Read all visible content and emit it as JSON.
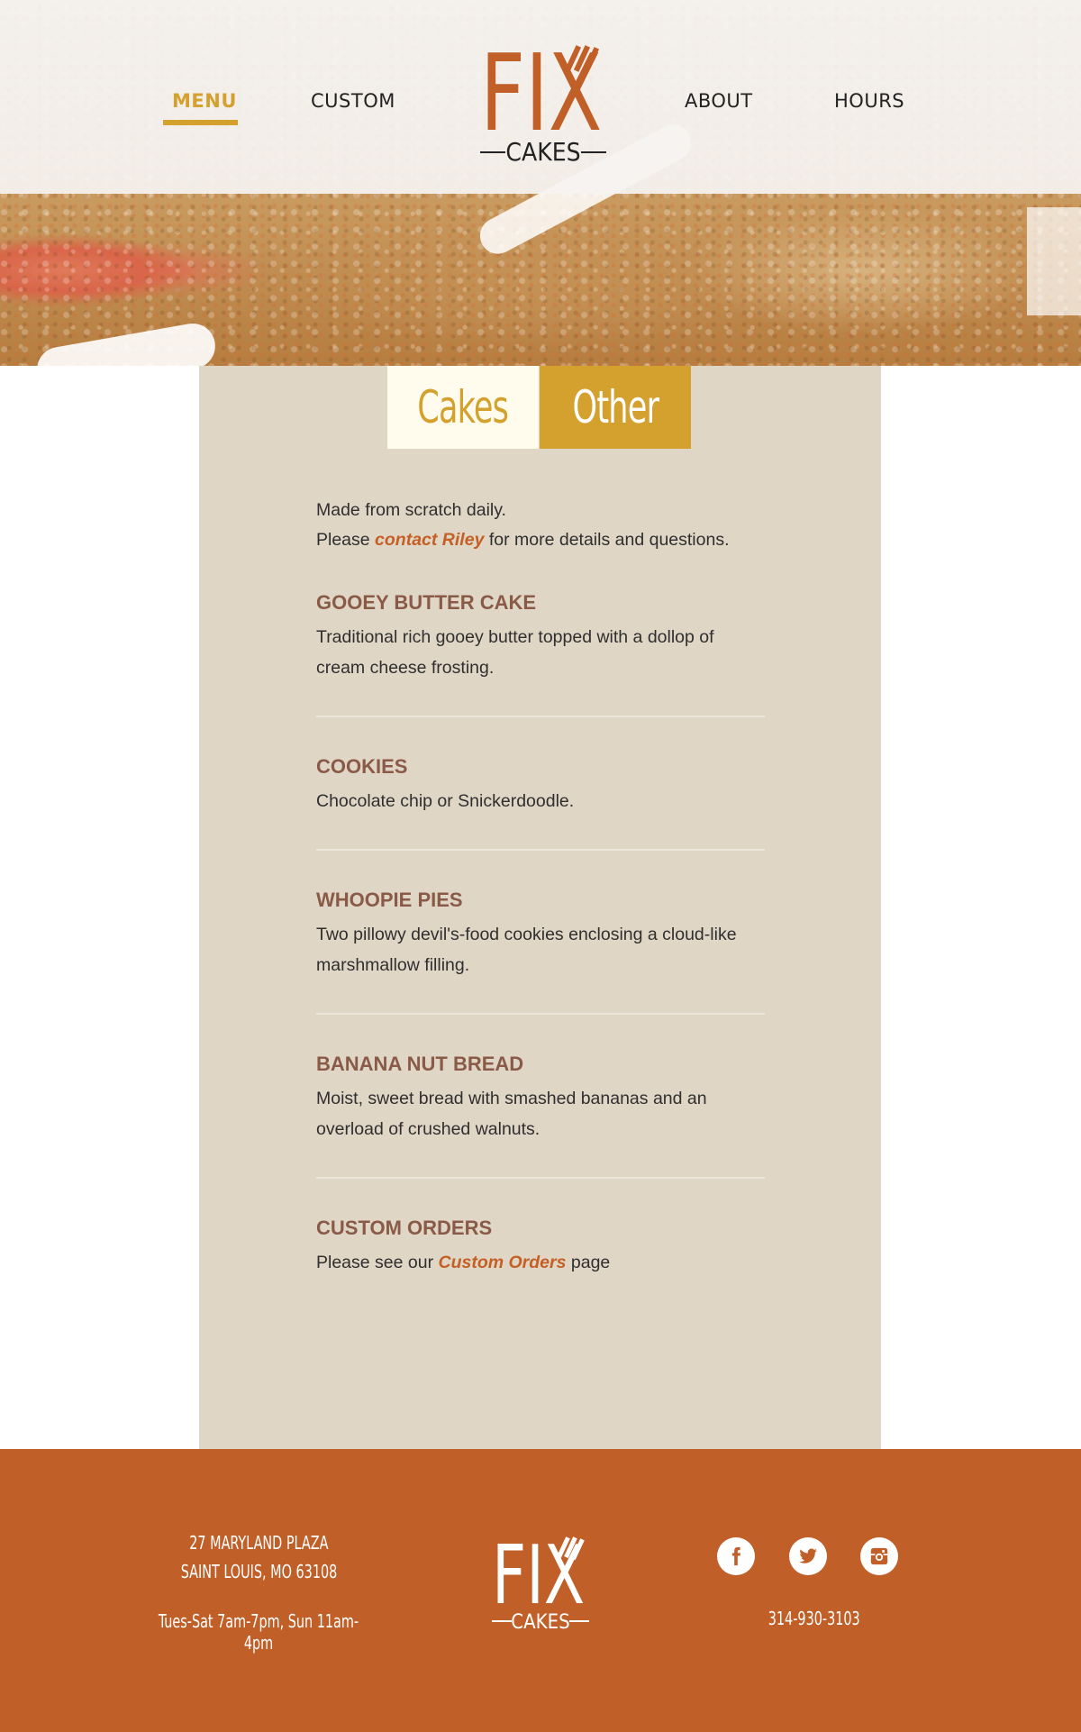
{
  "nav": {
    "left": [
      {
        "label": "MENU",
        "active": true
      },
      {
        "label": "CUSTOM",
        "active": false
      }
    ],
    "right": [
      {
        "label": "ABOUT"
      },
      {
        "label": "HOURS"
      }
    ],
    "logo": {
      "main": "FIX",
      "sub": "CAKES"
    }
  },
  "tabs": [
    {
      "label": "Cakes",
      "selected": false
    },
    {
      "label": "Other",
      "selected": true
    }
  ],
  "intro": {
    "line1": "Made from scratch daily.",
    "line2_before": "Please ",
    "line2_link": "contact Riley",
    "line2_after": " for more details and questions."
  },
  "items": [
    {
      "title": "GOOEY BUTTER CAKE",
      "description": "Traditional rich gooey butter topped with a dollop of cream cheese frosting."
    },
    {
      "title": "COOKIES",
      "description": "Chocolate chip or Snickerdoodle."
    },
    {
      "title": "WHOOPIE PIES",
      "description": "Two pillowy devil's-food cookies enclosing a cloud-like marshmallow filling."
    },
    {
      "title": "BANANA NUT BREAD",
      "description": "Moist, sweet bread with smashed bananas and an overload of crushed walnuts."
    }
  ],
  "custom_orders": {
    "title": "CUSTOM ORDERS",
    "before": "Please see our ",
    "link": "Custom Orders",
    "after": " page"
  },
  "footer": {
    "address_line1": "27 MARYLAND PLAZA",
    "address_line2": "SAINT LOUIS, MO 63108",
    "hours": "Tues-Sat 7am-7pm, Sun 11am-4pm",
    "phone": "314-930-3103",
    "logo": {
      "main": "FIX",
      "sub": "CAKES"
    },
    "social": [
      {
        "icon": "facebook-icon"
      },
      {
        "icon": "twitter-icon"
      },
      {
        "icon": "instagram-icon"
      }
    ]
  },
  "colors": {
    "accent": "#d4a02e",
    "brand": "#c05f27",
    "panel": "#e0d6c5",
    "item_title": "#8a5a48"
  }
}
